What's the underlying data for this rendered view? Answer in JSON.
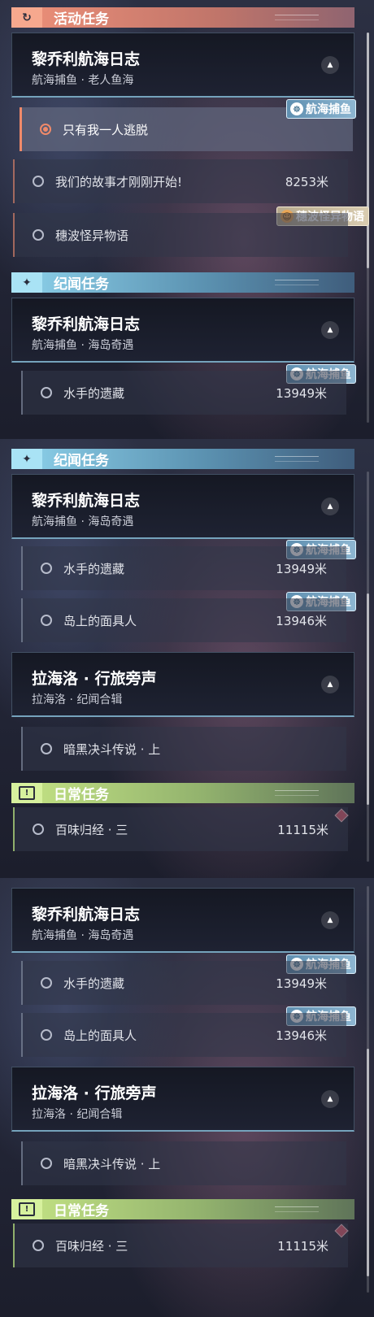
{
  "panel1": {
    "activity_section": {
      "title": "活动任务",
      "icon": "refresh-icon"
    },
    "activity_quest": {
      "title": "黎乔利航海日志",
      "subtitle": "航海捕鱼 · 老人鱼海"
    },
    "activity_tasks": [
      {
        "label": "只有我一人逃脱",
        "distance": "",
        "active": true
      },
      {
        "label": "我们的故事才刚刚开始!",
        "distance": "8253米"
      },
      {
        "label": "穗波怪异物语",
        "distance": ""
      }
    ],
    "tags": {
      "fishing": "航海捕鱼",
      "mascot": "穗波怪异物语"
    },
    "story_section": {
      "title": "纪闻任务",
      "icon": "sparkle-icon"
    },
    "story_quest": {
      "title": "黎乔利航海日志",
      "subtitle": "航海捕鱼 · 海岛奇遇"
    },
    "story_tasks": [
      {
        "label": "水手的遗藏",
        "distance": "13949米"
      }
    ]
  },
  "panel2": {
    "story_section": {
      "title": "纪闻任务"
    },
    "quest1": {
      "title": "黎乔利航海日志",
      "subtitle": "航海捕鱼 · 海岛奇遇"
    },
    "quest1_tasks": [
      {
        "label": "水手的遗藏",
        "distance": "13949米"
      },
      {
        "label": "岛上的面具人",
        "distance": "13946米"
      }
    ],
    "quest2": {
      "title": "拉海洛 · 行旅旁声",
      "subtitle": "拉海洛 · 纪闻合辑"
    },
    "quest2_tasks": [
      {
        "label": "暗黑决斗传说 · 上",
        "distance": ""
      }
    ],
    "daily_section": {
      "title": "日常任务",
      "icon": "exclamation-icon"
    },
    "daily_tasks": [
      {
        "label": "百味归经 · 三",
        "distance": "11115米"
      }
    ],
    "tags": {
      "fishing": "航海捕鱼"
    }
  },
  "panel3": {
    "quest1": {
      "title": "黎乔利航海日志",
      "subtitle": "航海捕鱼 · 海岛奇遇"
    },
    "quest1_tasks": [
      {
        "label": "水手的遗藏",
        "distance": "13949米"
      },
      {
        "label": "岛上的面具人",
        "distance": "13946米"
      }
    ],
    "quest2": {
      "title": "拉海洛 · 行旅旁声",
      "subtitle": "拉海洛 · 纪闻合辑"
    },
    "quest2_tasks": [
      {
        "label": "暗黑决斗传说 · 上",
        "distance": ""
      }
    ],
    "daily_section": {
      "title": "日常任务"
    },
    "daily_tasks": [
      {
        "label": "百味归经 · 三",
        "distance": "11115米"
      }
    ],
    "tags": {
      "fishing": "航海捕鱼"
    }
  }
}
